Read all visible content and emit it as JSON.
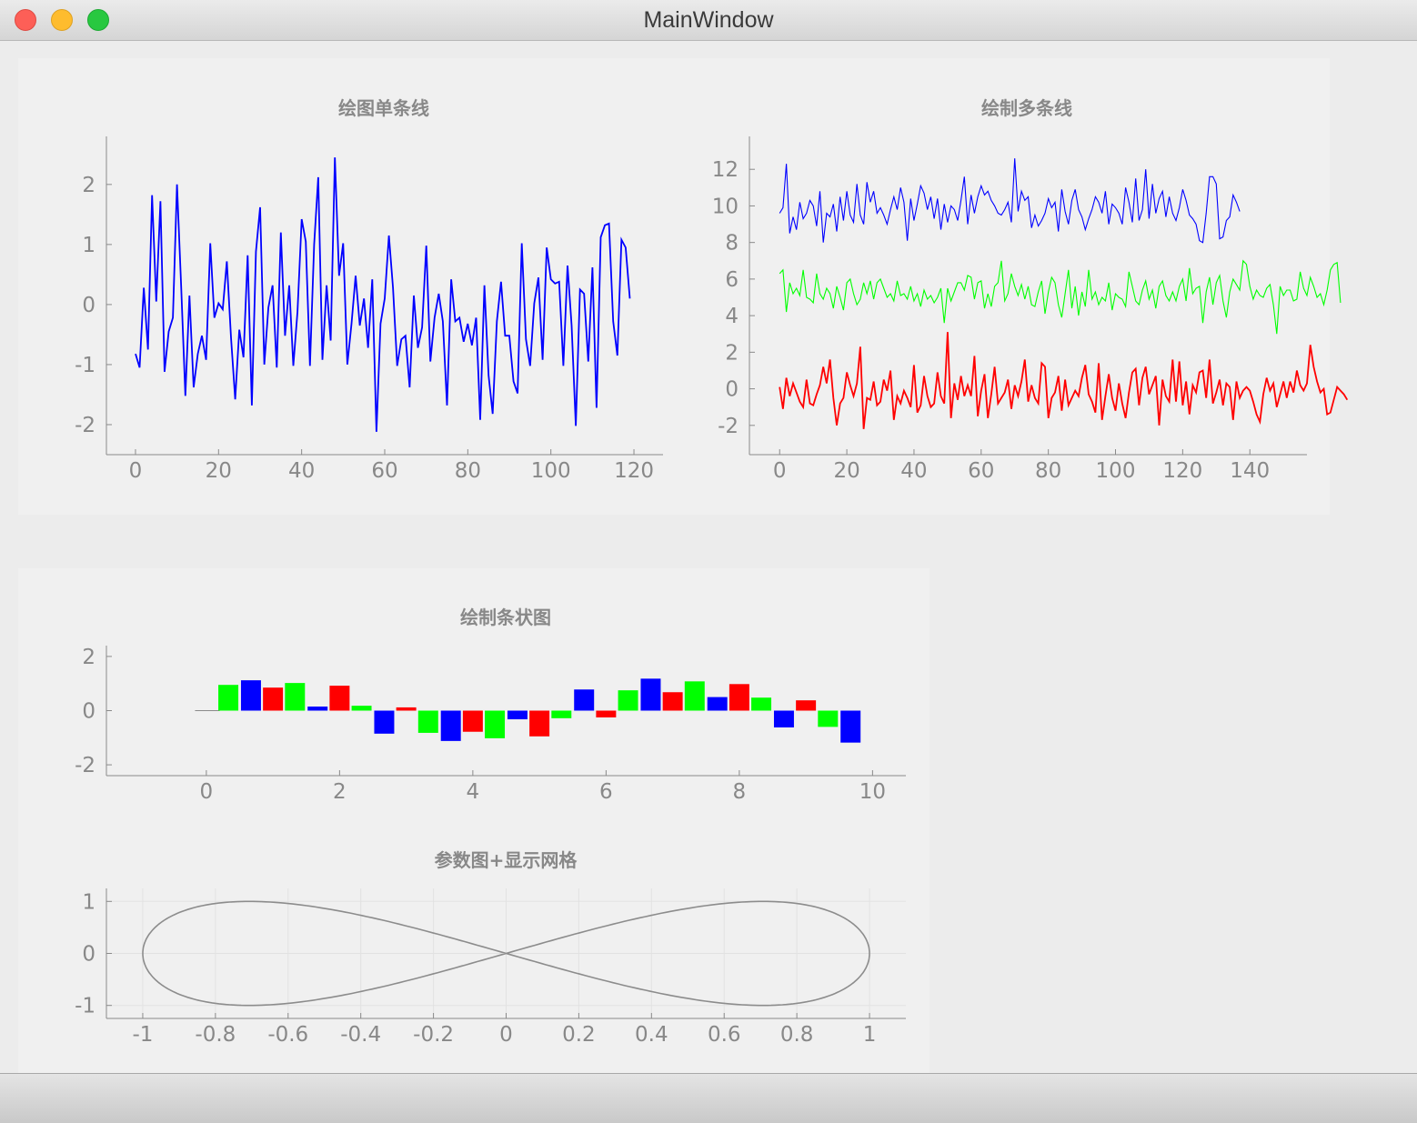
{
  "window": {
    "title": "MainWindow"
  },
  "colors": {
    "blue": "#0000ff",
    "green": "#00ff00",
    "red": "#ff0000",
    "axis": "#8a8a8a",
    "text": "#888888",
    "curve": "#8c8c8c"
  },
  "chart_data": [
    {
      "type": "line",
      "title": "绘图单条线",
      "xlabel": "",
      "ylabel": "",
      "xlim": [
        -7,
        127
      ],
      "ylim": [
        -2.5,
        2.8
      ],
      "xticks": [
        0,
        20,
        40,
        60,
        80,
        100,
        120
      ],
      "xtick_labels": [
        "0",
        "20",
        "40",
        "60",
        "80",
        "100",
        "120"
      ],
      "yticks": [
        -2,
        -1,
        0,
        1,
        2
      ],
      "ytick_labels": [
        "-2",
        "-1",
        "0",
        "1",
        "2"
      ],
      "series": [
        {
          "color": "#0000ff",
          "x_start": 0,
          "x_step": 1,
          "values": [
            -0.82,
            -1.05,
            0.28,
            -0.75,
            1.82,
            0.05,
            1.72,
            -1.12,
            -0.45,
            -0.22,
            2.0,
            0.3,
            -1.52,
            0.15,
            -1.38,
            -0.82,
            -0.52,
            -0.92,
            1.02,
            -0.22,
            0.02,
            -0.08,
            0.72,
            -0.55,
            -1.58,
            -0.42,
            -0.88,
            0.82,
            -1.68,
            0.88,
            1.62,
            -1.0,
            -0.05,
            0.32,
            -1.05,
            1.2,
            -0.52,
            0.32,
            -1.02,
            -0.12,
            1.42,
            1.05,
            -1.02,
            1.0,
            2.12,
            -0.92,
            0.32,
            -0.6,
            2.45,
            0.48,
            1.02,
            -1.0,
            -0.32,
            0.48,
            -0.35,
            0.1,
            -0.72,
            0.42,
            -2.12,
            -0.32,
            0.1,
            1.15,
            0.28,
            -1.02,
            -0.58,
            -0.52,
            -1.38,
            0.15,
            -0.72,
            -0.38,
            0.98,
            -0.95,
            -0.22,
            0.18,
            -0.28,
            -1.68,
            0.42,
            -0.28,
            -0.22,
            -0.62,
            -0.32,
            -0.68,
            -0.22,
            -1.92,
            0.32,
            -1.18,
            -1.82,
            -0.28,
            0.38,
            -0.52,
            -0.52,
            -1.28,
            -1.48,
            1.02,
            -0.58,
            -1.02,
            0.02,
            0.45,
            -0.92,
            0.95,
            0.42,
            0.35,
            0.38,
            -1.02,
            0.65,
            -0.35,
            -2.02,
            0.25,
            0.18,
            -0.95,
            0.62,
            -1.72,
            1.12,
            1.32,
            1.35,
            -0.28,
            -0.85,
            1.08,
            0.95,
            0.1
          ]
        }
      ]
    },
    {
      "type": "line",
      "title": "绘制多条线",
      "xlabel": "",
      "ylabel": "",
      "xlim": [
        -9,
        157
      ],
      "ylim": [
        -3.6,
        13.8
      ],
      "xticks": [
        0,
        20,
        40,
        60,
        80,
        100,
        120,
        140
      ],
      "xtick_labels": [
        "0",
        "20",
        "40",
        "60",
        "80",
        "100",
        "120",
        "140"
      ],
      "yticks": [
        -2,
        0,
        2,
        4,
        6,
        8,
        10,
        12
      ],
      "ytick_labels": [
        "-2",
        "0",
        "2",
        "4",
        "6",
        "8",
        "10",
        "12"
      ],
      "series": [
        {
          "color": "#0000ff",
          "x_start": 0,
          "x_step": 1,
          "values": [
            9.6,
            9.9,
            12.3,
            8.5,
            9.4,
            8.7,
            10.2,
            9.3,
            9.6,
            10.3,
            10.0,
            8.9,
            10.8,
            8.0,
            9.6,
            9.4,
            10.1,
            8.6,
            10.5,
            9.2,
            10.8,
            9.5,
            9.1,
            11.2,
            9.5,
            9.0,
            11.3,
            10.2,
            10.8,
            9.6,
            9.9,
            9.5,
            9.0,
            9.8,
            10.5,
            9.8,
            11.0,
            10.2,
            8.1,
            10.4,
            9.2,
            10.1,
            11.1,
            10.7,
            9.8,
            10.5,
            9.3,
            10.4,
            8.7,
            10.1,
            9.1,
            10.0,
            9.8,
            9.2,
            10.3,
            11.6,
            9.0,
            10.6,
            9.6,
            10.5,
            11.1,
            10.6,
            10.8,
            10.3,
            10.0,
            9.6,
            9.5,
            9.8,
            10.2,
            9.1,
            12.6,
            9.7,
            10.8,
            10.3,
            10.5,
            8.8,
            9.5,
            8.9,
            9.2,
            9.6,
            10.4,
            9.9,
            10.2,
            8.6,
            10.9,
            9.7,
            9.0,
            10.3,
            10.9,
            9.8,
            9.4,
            8.7,
            9.3,
            9.8,
            10.5,
            10.2,
            9.6,
            10.8,
            9.0,
            10.1,
            9.9,
            9.6,
            9.0,
            11.0,
            10.2,
            9.1,
            11.5,
            9.2,
            9.8,
            12.0,
            9.3,
            11.2,
            9.6,
            10.4,
            10.8,
            9.4,
            10.5,
            9.6,
            9.2,
            9.9,
            10.9,
            10.3,
            9.5,
            9.3,
            9.0,
            8.1,
            8.0,
            9.6,
            11.6,
            11.6,
            11.2,
            8.2,
            8.3,
            9.2,
            9.4,
            10.6,
            10.2,
            9.7
          ]
        },
        {
          "color": "#00ff00",
          "x_start": 0,
          "x_step": 1,
          "values": [
            6.3,
            6.5,
            4.2,
            5.8,
            5.2,
            5.5,
            5.1,
            6.5,
            5.0,
            4.9,
            4.7,
            6.3,
            5.2,
            4.9,
            5.5,
            5.2,
            4.4,
            5.6,
            5.0,
            4.3,
            5.8,
            6.0,
            5.2,
            4.6,
            4.9,
            5.8,
            5.2,
            5.9,
            4.9,
            5.8,
            6.0,
            5.5,
            5.0,
            5.2,
            4.8,
            5.9,
            5.1,
            5.2,
            4.9,
            5.6,
            4.8,
            5.2,
            4.5,
            5.4,
            4.9,
            5.1,
            4.7,
            5.0,
            5.5,
            3.6,
            5.5,
            4.8,
            5.3,
            5.8,
            5.8,
            5.4,
            6.2,
            6.1,
            4.9,
            5.8,
            5.9,
            4.4,
            5.2,
            4.5,
            5.6,
            5.8,
            7.0,
            4.8,
            5.2,
            6.3,
            5.6,
            5.1,
            5.7,
            4.9,
            5.6,
            4.6,
            4.5,
            5.3,
            5.9,
            4.1,
            5.3,
            6.1,
            5.8,
            4.6,
            3.9,
            5.2,
            6.5,
            4.4,
            5.6,
            4.0,
            5.3,
            4.5,
            6.5,
            4.9,
            5.3,
            4.6,
            5.0,
            4.8,
            5.8,
            4.3,
            5.2,
            5.0,
            4.9,
            4.5,
            6.4,
            5.6,
            4.8,
            4.6,
            5.4,
            5.9,
            4.9,
            5.4,
            4.4,
            5.6,
            5.9,
            5.1,
            4.8,
            5.3,
            4.8,
            5.6,
            6.0,
            4.8,
            6.6,
            5.2,
            5.5,
            5.6,
            3.6,
            5.3,
            6.1,
            4.6,
            5.8,
            6.2,
            4.8,
            3.9,
            5.3,
            6.0,
            5.7,
            5.4,
            7.0,
            6.8,
            5.6,
            4.9,
            5.4,
            5.1,
            5.0,
            5.5,
            5.7,
            4.6,
            3.0,
            5.6,
            5.1,
            5.4,
            5.4,
            4.8,
            4.9,
            6.4,
            5.5,
            5.1,
            6.1,
            5.6,
            5.0,
            5.2,
            4.6,
            5.4,
            6.5,
            6.8,
            6.9,
            4.7
          ]
        },
        {
          "color": "#ff0000",
          "x_start": 0,
          "x_step": 1,
          "values": [
            0.1,
            -1.1,
            0.6,
            -0.4,
            0.3,
            -0.2,
            -0.7,
            -1.0,
            0.5,
            -0.8,
            -0.9,
            -0.3,
            0.2,
            1.2,
            0.3,
            1.6,
            -0.5,
            -2.0,
            -0.8,
            -0.5,
            0.9,
            0.2,
            -0.4,
            0.3,
            2.3,
            -2.2,
            -0.5,
            -0.6,
            0.4,
            -0.9,
            -0.7,
            0.5,
            -0.1,
            1.0,
            -1.7,
            -0.4,
            -0.8,
            -0.1,
            -0.5,
            -1.0,
            1.3,
            -1.3,
            -0.9,
            0.7,
            -0.4,
            -1.0,
            -0.8,
            0.9,
            -0.4,
            -0.8,
            3.1,
            -1.6,
            0.3,
            -0.6,
            0.7,
            -0.4,
            0.2,
            -0.4,
            1.8,
            -1.5,
            -0.1,
            0.8,
            -1.6,
            -0.3,
            1.2,
            -0.8,
            -0.5,
            -0.2,
            0.5,
            -1.1,
            0.2,
            -0.4,
            0.4,
            1.6,
            -0.7,
            0.2,
            -0.5,
            -0.8,
            1.4,
            1.2,
            -1.6,
            -0.5,
            -0.2,
            0.7,
            -1.2,
            0.5,
            -0.9,
            -0.5,
            -0.1,
            -0.4,
            0.6,
            1.3,
            -0.3,
            -0.7,
            -1.3,
            1.4,
            -1.7,
            -0.4,
            0.8,
            -0.5,
            -1.2,
            0.3,
            -0.8,
            -1.6,
            -0.2,
            0.9,
            1.1,
            -0.9,
            0.6,
            1.2,
            -0.3,
            0.2,
            0.7,
            -2.0,
            0.5,
            -0.4,
            -0.7,
            1.6,
            -0.7,
            1.5,
            -0.9,
            0.4,
            -1.4,
            0.2,
            -0.2,
            0.9,
            1.0,
            -0.5,
            1.6,
            -0.8,
            -0.2,
            0.5,
            -0.9,
            0.3,
            0.1,
            -1.7,
            0.4,
            -0.5,
            -0.1,
            0.1,
            -0.1,
            -0.7,
            -1.4,
            -1.8,
            -0.3,
            0.6,
            -0.1,
            0.3,
            -1.0,
            -0.3,
            0.4,
            -0.5,
            0.4,
            -0.2,
            1.0,
            0.2,
            -0.1,
            0.3,
            2.4,
            1.2,
            0.4,
            -0.2,
            0.0,
            -1.4,
            -1.3,
            -0.6,
            0.1,
            -0.1,
            -0.3,
            -0.6
          ]
        }
      ]
    },
    {
      "type": "bar",
      "title": "绘制条状图",
      "xlabel": "",
      "ylabel": "",
      "xlim": [
        -1.5,
        10.5
      ],
      "ylim": [
        -2.4,
        2.4
      ],
      "xticks": [
        0,
        2,
        4,
        6,
        8,
        10
      ],
      "xtick_labels": [
        "0",
        "2",
        "4",
        "6",
        "8",
        "10"
      ],
      "yticks": [
        -2,
        0,
        2
      ],
      "ytick_labels": [
        "-2",
        "0",
        "2"
      ],
      "bar_width": 0.3,
      "baseline_x": [
        -0.17,
        0.2
      ],
      "bar_colors_cycle": [
        "#00ff00",
        "#0000ff",
        "#ff0000"
      ],
      "x": [
        0.33,
        0.67,
        1.0,
        1.33,
        1.67,
        2.0,
        2.33,
        2.67,
        3.0,
        3.33,
        3.67,
        4.0,
        4.33,
        4.67,
        5.0,
        5.33,
        5.67,
        6.0,
        6.33,
        6.67,
        7.0,
        7.33,
        7.67,
        8.0,
        8.33,
        8.67,
        9.0,
        9.33,
        9.67
      ],
      "values": [
        0.95,
        1.12,
        0.85,
        1.02,
        0.15,
        0.92,
        0.18,
        -0.85,
        0.12,
        -0.82,
        -1.12,
        -0.78,
        -1.02,
        -0.32,
        -0.95,
        -0.28,
        0.78,
        -0.25,
        0.75,
        1.18,
        0.68,
        1.08,
        0.5,
        0.98,
        0.48,
        -0.62,
        0.38,
        -0.6,
        -1.18
      ]
    },
    {
      "type": "line",
      "title": "参数图+显示网格",
      "xlabel": "",
      "ylabel": "",
      "xlim": [
        -1.1,
        1.1
      ],
      "ylim": [
        -1.25,
        1.25
      ],
      "xticks": [
        -1,
        -0.8,
        -0.6,
        -0.4,
        -0.2,
        0,
        0.2,
        0.4,
        0.6,
        0.8,
        1
      ],
      "xtick_labels": [
        "-1",
        "-0.8",
        "-0.6",
        "-0.4",
        "-0.2",
        "0",
        "0.2",
        "0.4",
        "0.6",
        "0.8",
        "1"
      ],
      "yticks": [
        -1,
        0,
        1
      ],
      "ytick_labels": [
        "-1",
        "0",
        "1"
      ],
      "series": [
        {
          "color": "#8c8c8c",
          "parametric": "x = cos(t), y = sin(2t), t in [0, 2π]"
        }
      ]
    }
  ]
}
